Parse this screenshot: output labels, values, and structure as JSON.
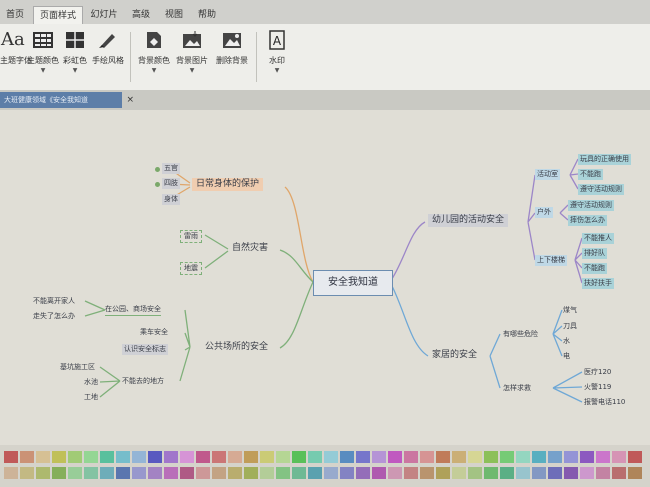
{
  "tabs": [
    "首页",
    "页面样式",
    "幻灯片",
    "高级",
    "视图",
    "帮助"
  ],
  "ribbon": {
    "buttons": [
      {
        "label": "主题字体",
        "icon": "font-icon"
      },
      {
        "label": "主题颜色",
        "icon": "theme-color-icon"
      },
      {
        "label": "彩虹色",
        "icon": "rainbow-icon"
      },
      {
        "label": "手绘风格",
        "icon": "brush-icon"
      },
      {
        "label": "背景颜色",
        "icon": "bg-color-icon"
      },
      {
        "label": "背景图片",
        "icon": "bg-image-icon"
      },
      {
        "label": "删除背景",
        "icon": "remove-bg-icon"
      },
      {
        "label": "水印",
        "icon": "watermark-icon"
      }
    ]
  },
  "doc_tab": {
    "title": "大班健康领域《安全我知道",
    "close": "×"
  },
  "mindmap": {
    "central": "安全我知道",
    "left": [
      {
        "label": "日常身体的保护",
        "children": [
          "五官",
          "四肢",
          "身体"
        ]
      },
      {
        "label": "自然灾害",
        "children": [
          "雷雨",
          "地震"
        ]
      },
      {
        "label": "公共场所的安全",
        "children": [
          {
            "label": "在公园、商场安全",
            "children": [
              "不能离开家人",
              "走失了怎么办"
            ]
          },
          {
            "label": "乘车安全"
          },
          {
            "label": "认识安全标志"
          },
          {
            "label": "不能去的地方",
            "children": [
              "基坑施工区",
              "水池",
              "工地"
            ]
          }
        ]
      }
    ],
    "right": [
      {
        "label": "幼儿园的活动安全",
        "children": [
          {
            "label": "活动室",
            "children": [
              "玩具的正确使用",
              "不能跑",
              "遵守活动规则"
            ]
          },
          {
            "label": "户外",
            "children": [
              "遵守活动规则",
              "摔伤怎么办"
            ]
          },
          {
            "label": "上下楼梯",
            "children": [
              "不能推人",
              "排好队",
              "不能跑",
              "扶好扶手"
            ]
          }
        ]
      },
      {
        "label": "家居的安全",
        "children": [
          {
            "label": "有哪些危险",
            "children": [
              "煤气",
              "刀具",
              "水",
              "电"
            ]
          },
          {
            "label": "怎样求救",
            "children": [
              "医疗120",
              "火警119",
              "报警电话110"
            ]
          }
        ]
      }
    ]
  },
  "colors": {
    "accent": "#5d7ea8",
    "branch_orange": "#e0a66a",
    "branch_green": "#7fb07a",
    "branch_blue": "#6fa8d6",
    "branch_purple": "#9c86c8"
  }
}
